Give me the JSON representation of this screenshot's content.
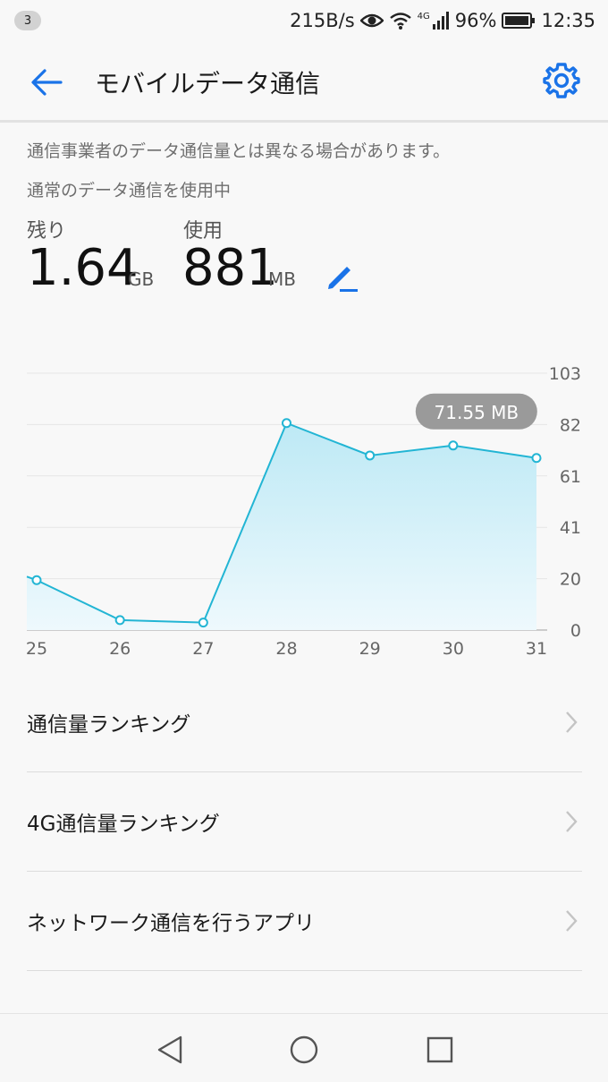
{
  "status_bar": {
    "notification_count": "3",
    "net_speed": "215B/s",
    "network_type": "4G",
    "battery": "96%",
    "time": "12:35"
  },
  "app_bar": {
    "title": "モバイルデータ通信",
    "back_icon": "arrow-left-icon",
    "settings_icon": "gear-icon"
  },
  "notes": {
    "carrier_disclaimer": "通信事業者のデータ通信量とは異なる場合があります。",
    "mode_status": "通常のデータ通信を使用中"
  },
  "usage": {
    "remaining_label": "残り",
    "remaining_value": "1.64",
    "remaining_unit": "GB",
    "used_label": "使用",
    "used_value": "881",
    "used_unit": "MB"
  },
  "chart_data": {
    "type": "area",
    "x": [
      "25",
      "26",
      "27",
      "28",
      "29",
      "30",
      "31"
    ],
    "values": [
      20,
      4,
      3,
      83,
      70,
      74,
      69
    ],
    "y_ticks": [
      "103",
      "82",
      "61",
      "41",
      "20",
      "0"
    ],
    "ylim": [
      0,
      103
    ],
    "selected_tooltip": "71.55 MB",
    "selected_index": 5,
    "grid": true,
    "colors": {
      "line": "#22b5d4",
      "fill_top": "#bde9f5",
      "fill_bottom": "#eef9fd",
      "tooltip": "#9a9a9a"
    }
  },
  "list": {
    "items": [
      {
        "label": "通信量ランキング"
      },
      {
        "label": "4G通信量ランキング"
      },
      {
        "label": "ネットワーク通信を行うアプリ"
      }
    ]
  },
  "nav": {
    "back_icon": "triangle-back-icon",
    "home_icon": "circle-home-icon",
    "recents_icon": "square-recents-icon"
  },
  "colors": {
    "accent": "#1a73e8"
  }
}
